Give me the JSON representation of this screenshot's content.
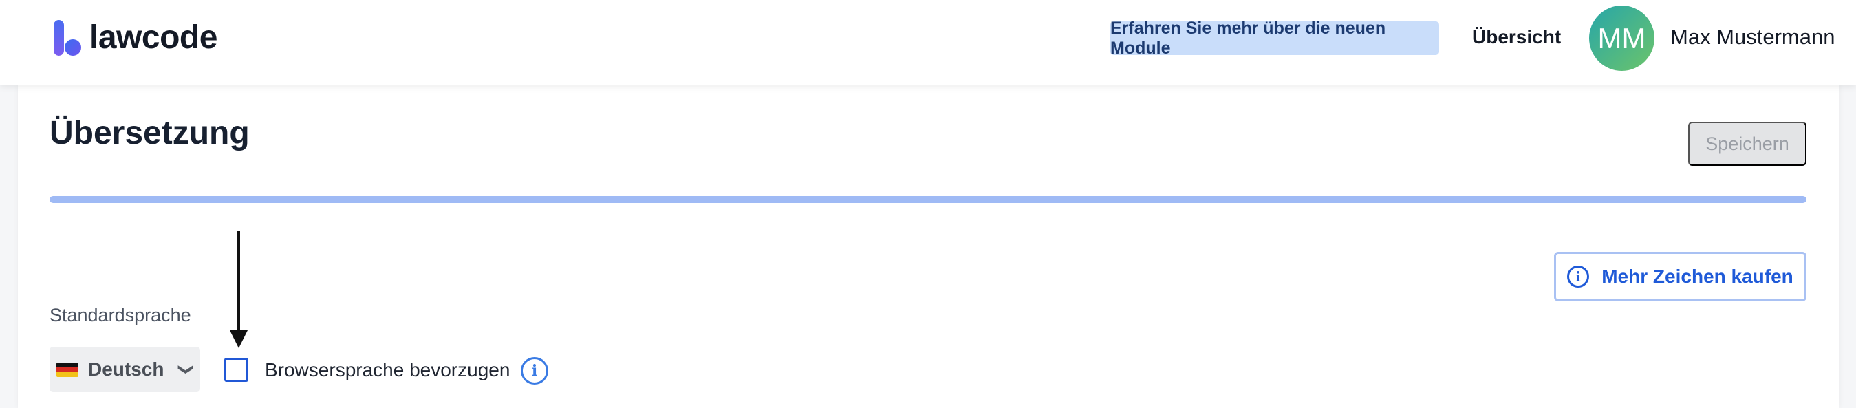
{
  "header": {
    "logo_text": "lawcode",
    "promo_label": "Erfahren Sie mehr über die neuen Module",
    "nav_overview": "Übersicht",
    "avatar_initials": "MM",
    "user_name": "Max Mustermann"
  },
  "page": {
    "title": "Übersetzung",
    "save_label": "Speichern",
    "progress_fraction": 1.0
  },
  "translation": {
    "buy_label": "Mehr Zeichen kaufen",
    "buy_icon": "info-icon",
    "default_language_label": "Standardsprache",
    "language_value": "Deutsch",
    "language_flag": "germany-flag",
    "browser_language_label": "Browsersprache bevorzugen",
    "browser_language_checked": false,
    "info_icon": "info-icon"
  },
  "colors": {
    "accent": "#1f5ad8",
    "progress": "#9fbaf5",
    "promo_bg": "#c9ddfa",
    "avatar_from": "#27a6a9",
    "avatar_to": "#6cc46a"
  }
}
